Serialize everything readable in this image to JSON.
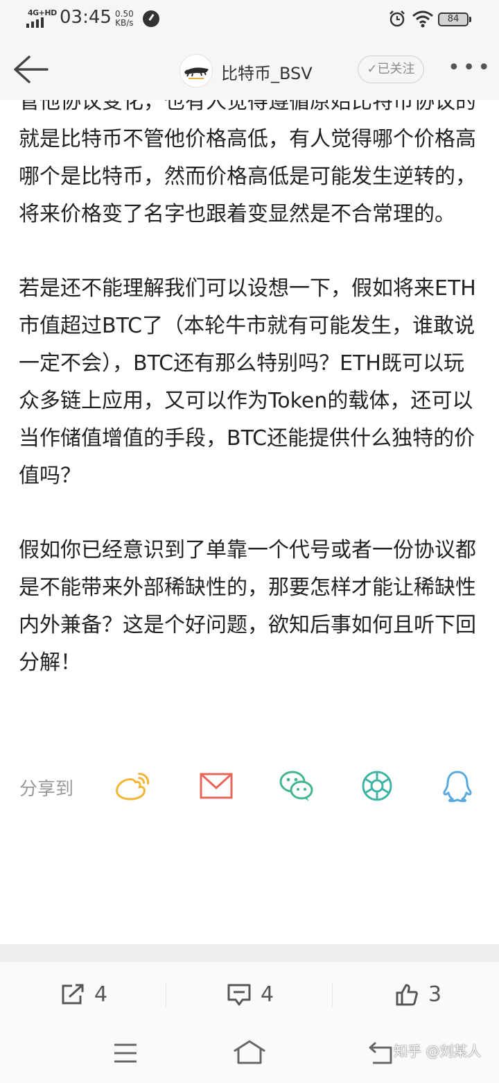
{
  "status_bar": {
    "network": "4G+HD",
    "time": "03:45",
    "speed_value": "0.50",
    "speed_unit": "KB/s",
    "battery": "84"
  },
  "header": {
    "title": "比特币_BSV",
    "follow_label": "✓已关注",
    "more_label": "•••"
  },
  "article": {
    "paragraphs": [
      "管他协议变化，也有人觉得遵循原始比特币协议的就是比特币不管他价格高低，有人觉得哪个价格高哪个是比特币，然而价格高低是可能发生逆转的，将来价格变了名字也跟着变显然是不合常理的。",
      "若是还不能理解我们可以设想一下，假如将来ETH市值超过BTC了（本轮牛市就有可能发生，谁敢说一定不会），BTC还有那么特别吗？ETH既可以玩众多链上应用，又可以作为Token的载体，还可以当作储值增值的手段，BTC还能提供什么独特的价值吗？",
      "假如你已经意识到了单靠一个代号或者一份协议都是不能带来外部稀缺性的，那要怎样才能让稀缺性内外兼备？这是个好问题，欲知后事如何且听下回分解！"
    ]
  },
  "share": {
    "label": "分享到",
    "icons": [
      "weibo-icon",
      "mail-icon",
      "wechat-icon",
      "moments-icon",
      "qq-icon"
    ],
    "colors": {
      "weibo": "#f2b535",
      "mail": "#e8655a",
      "wechat": "#3fb68e",
      "moments": "#3fb2a6",
      "qq": "#5aa9dd"
    }
  },
  "actions": {
    "share_count": "4",
    "comment_count": "4",
    "like_count": "3"
  },
  "watermark": "知乎 @刘某人"
}
